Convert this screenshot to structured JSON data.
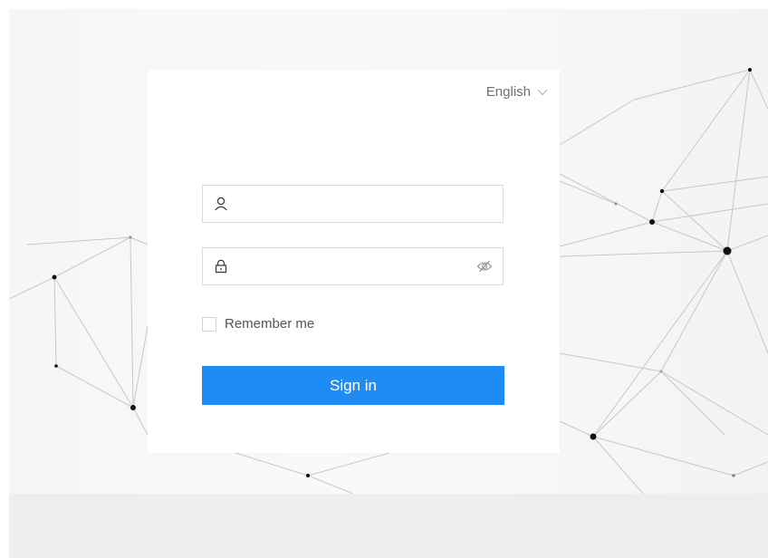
{
  "language": {
    "selected": "English",
    "icon": "chevron-down-icon"
  },
  "username": {
    "value": "",
    "placeholder": "",
    "icon": "user-icon"
  },
  "password": {
    "value": "",
    "placeholder": "",
    "icon": "lock-icon",
    "toggle_icon": "eye-off-icon"
  },
  "remember": {
    "label": "Remember me",
    "checked": false
  },
  "signin": {
    "label": "Sign in"
  },
  "colors": {
    "primary": "#1f8cf5",
    "page_background": "#eeeeee",
    "card_background": "#ffffff",
    "border": "#dcdcdc"
  }
}
